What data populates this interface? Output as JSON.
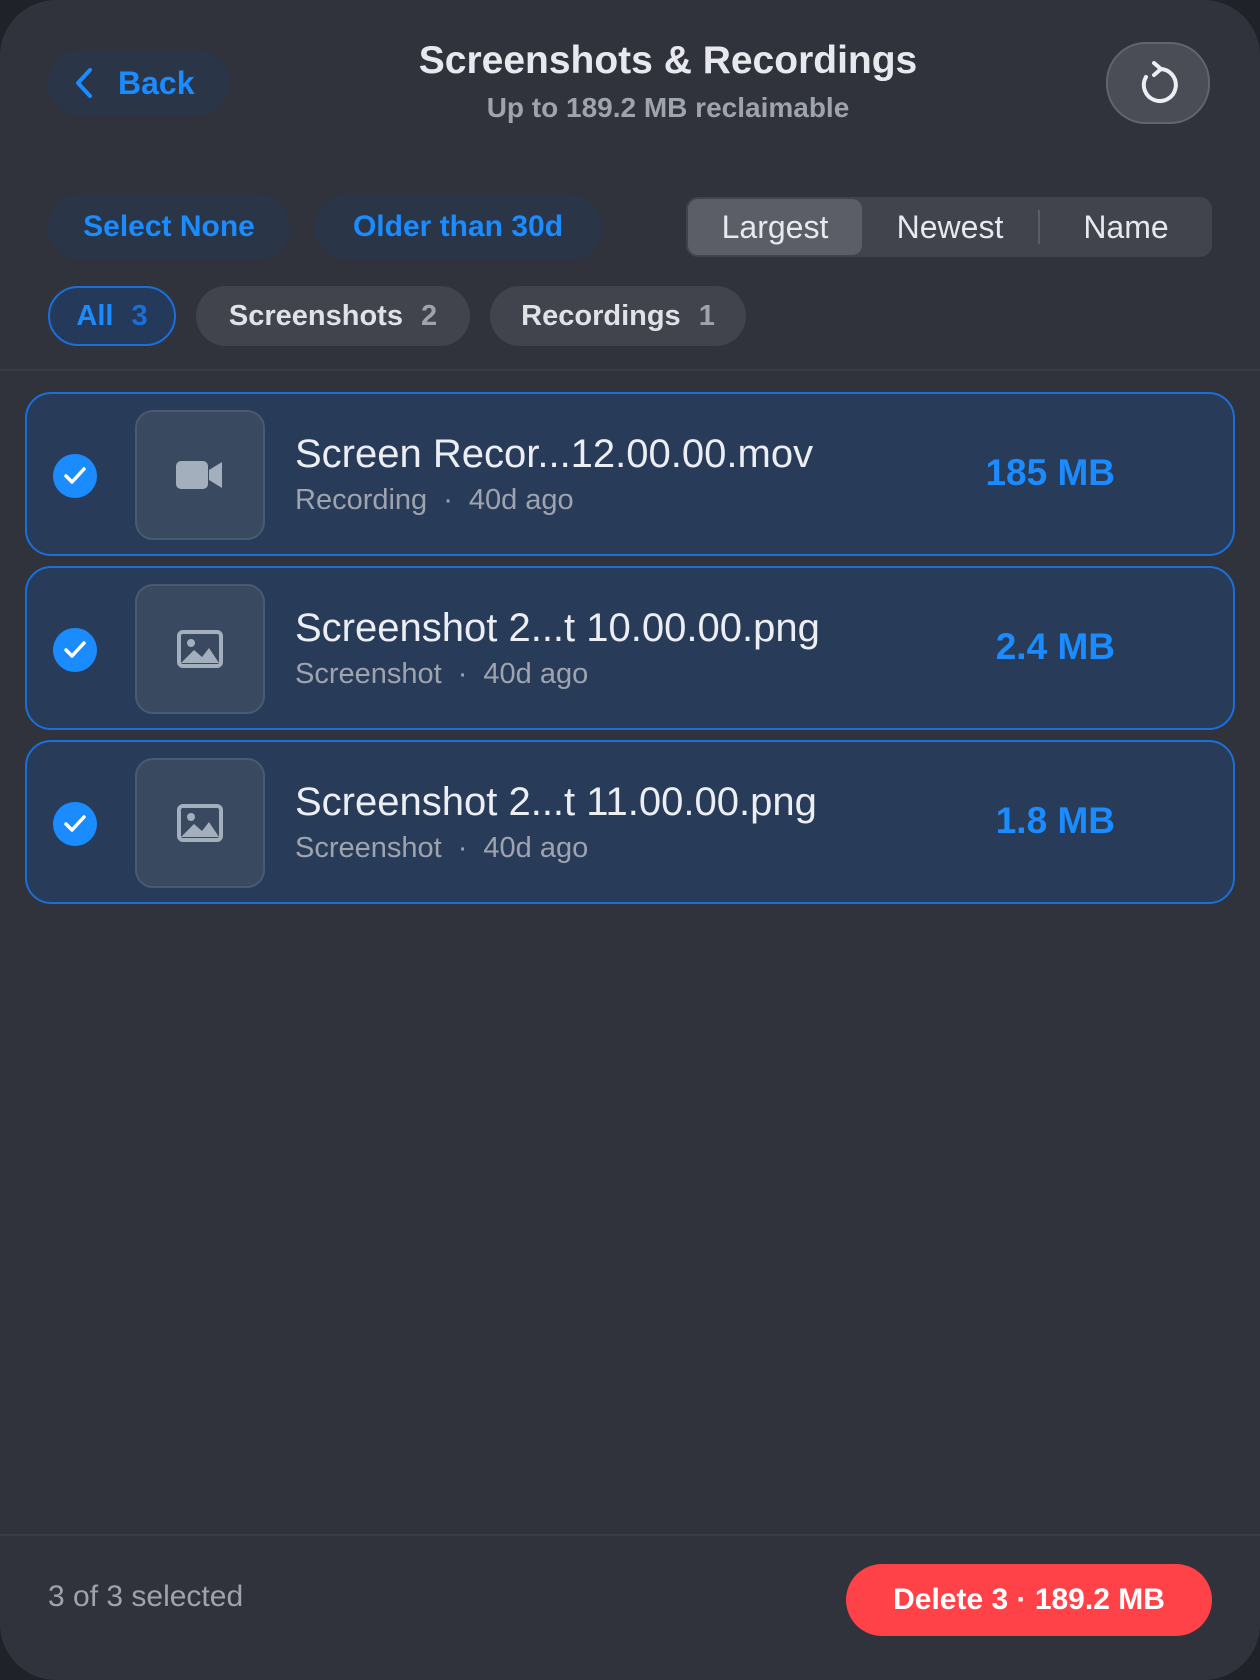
{
  "header": {
    "back_label": "Back",
    "title": "Screenshots & Recordings",
    "subtitle": "Up to 189.2 MB reclaimable"
  },
  "toolbar": {
    "select_none_label": "Select None",
    "older_than_label": "Older than 30d",
    "sort_options": [
      "Largest",
      "Newest",
      "Name"
    ],
    "sort_selected": "Largest"
  },
  "filters": [
    {
      "label": "All",
      "count": "3",
      "active": true
    },
    {
      "label": "Screenshots",
      "count": "2",
      "active": false
    },
    {
      "label": "Recordings",
      "count": "1",
      "active": false
    }
  ],
  "files": [
    {
      "name": "Screen Recor...12.00.00.mov",
      "type": "Recording",
      "separator": "·",
      "age": "40d ago",
      "size": "185 MB",
      "icon": "video-camera-icon",
      "selected": true
    },
    {
      "name": "Screenshot 2...t 10.00.00.png",
      "type": "Screenshot",
      "separator": "·",
      "age": "40d ago",
      "size": "2.4 MB",
      "icon": "image-icon",
      "selected": true
    },
    {
      "name": "Screenshot 2...t 11.00.00.png",
      "type": "Screenshot",
      "separator": "·",
      "age": "40d ago",
      "size": "1.8 MB",
      "icon": "image-icon",
      "selected": true
    }
  ],
  "footer": {
    "selected_text": "3 of 3 selected",
    "delete_label": "Delete 3 · 189.2 MB"
  },
  "colors": {
    "accent": "#1a8cff",
    "danger": "#ff4248",
    "background": "#30333c"
  }
}
